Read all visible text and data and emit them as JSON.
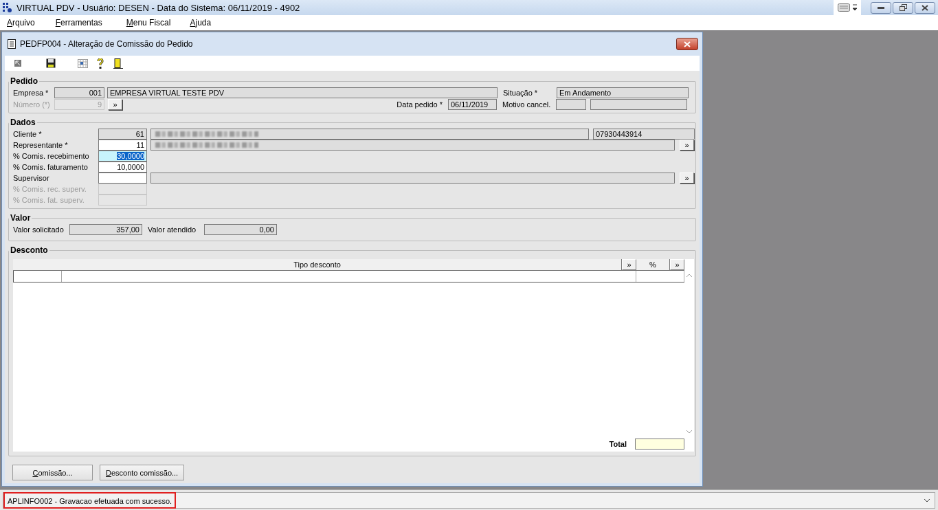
{
  "app": {
    "title": "VIRTUAL PDV - Usuário: DESEN - Data do Sistema: 06/11/2019 - 4902"
  },
  "menu": [
    {
      "label": "Arquivo"
    },
    {
      "label": "Ferramentas"
    },
    {
      "label": "Menu Fiscal"
    },
    {
      "label": "Ajuda"
    }
  ],
  "window": {
    "title": "PEDFP004 - Alteração de Comissão do Pedido"
  },
  "pedido": {
    "legend": "Pedido",
    "empresa": {
      "label": "Empresa *",
      "code": "001",
      "name": "EMPRESA VIRTUAL TESTE PDV"
    },
    "numero": {
      "label": "Número (*)",
      "value": "9",
      "disabled": true,
      "button": "»"
    },
    "data_pedido": {
      "label": "Data pedido *",
      "value": "06/11/2019"
    },
    "situacao": {
      "label": "Situação *",
      "value": "Em Andamento"
    },
    "motivo_cancel": {
      "label": "Motivo cancel."
    }
  },
  "dados": {
    "legend": "Dados",
    "rows": [
      {
        "kind": "client",
        "label": "Cliente *",
        "value": "61",
        "readonly": true,
        "name_redacted": true,
        "doc": "07930443914"
      },
      {
        "kind": "lookup",
        "label": "Representante *",
        "value": "11",
        "name_redacted": true,
        "button": "»"
      },
      {
        "kind": "plain",
        "label": "% Comis. recebimento",
        "value": "30,0000",
        "selected": true
      },
      {
        "kind": "plain",
        "label": "% Comis. faturamento",
        "value": "10,0000",
        "selected": false
      },
      {
        "kind": "lookup",
        "label": "Supervisor",
        "name_redacted": false,
        "button": "»"
      },
      {
        "kind": "plain",
        "label": "% Comis. rec. superv.",
        "disabled": true
      },
      {
        "kind": "plain",
        "label": "% Comis. fat. superv.",
        "disabled": true
      }
    ]
  },
  "valor": {
    "legend": "Valor",
    "fields": [
      {
        "label": "Valor solicitado",
        "value": "357,00"
      },
      {
        "label": "Valor atendido",
        "value": "0,00"
      }
    ]
  },
  "desconto": {
    "legend": "Desconto",
    "columns": [
      {
        "label": "Tipo desconto",
        "button": "»"
      },
      {
        "label": "%",
        "button": "»"
      }
    ],
    "total_label": "Total"
  },
  "buttons": [
    {
      "label": "Comissão..."
    },
    {
      "label": "Desconto comissão..."
    }
  ],
  "status": {
    "message": "APLINFO002 - Gravacao efetuada com sucesso.",
    "highlighted": true
  }
}
